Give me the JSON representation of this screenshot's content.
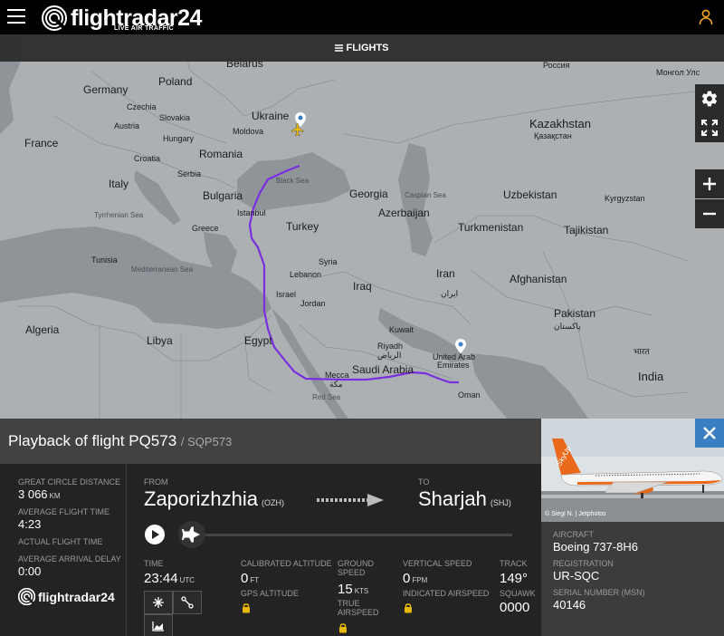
{
  "header": {
    "logo_text": "flightradar24",
    "logo_sub": "LIVE AIR TRAFFIC",
    "flights_label": "FLIGHTS"
  },
  "icons": {
    "menu": "hamburger-icon",
    "user": "user-icon",
    "settings": "gear-icon",
    "fullscreen": "fullscreen-icon",
    "zoom_in": "plus-icon",
    "zoom_out": "minus-icon",
    "close": "close-icon",
    "play": "play-icon",
    "plane": "plane-icon"
  },
  "map": {
    "labels": {
      "belarus": "Belarus",
      "germany": "Germany",
      "poland": "Poland",
      "czechia": "Czechia",
      "slovakia": "Slovakia",
      "austria": "Austria",
      "hungary": "Hungary",
      "ukraine": "Ukraine",
      "moldova": "Moldova",
      "france": "France",
      "romania": "Romania",
      "kazakhstan": "Kazakhstan",
      "kazakhstan_local": "Қазақстан",
      "russia_local": "Россия",
      "mongolia_local": "Монгол Улс",
      "croatia": "Croatia",
      "serbia": "Serbia",
      "italy": "Italy",
      "bulgaria": "Bulgaria",
      "istanbul": "Istanbul",
      "black_sea": "Black Sea",
      "georgia": "Georgia",
      "azerbaijan": "Azerbaijan",
      "caspian": "Caspian Sea",
      "uzbekistan": "Uzbekistan",
      "kyrgyzstan": "Kyrgyzstan",
      "tajikistan": "Tajikistan",
      "turkmenistan": "Turkmenistan",
      "turkey": "Turkey",
      "tyrrhenian": "Tyrrhenian Sea",
      "greece": "Greece",
      "med_sea": "Mediterranean Sea",
      "tunisia": "Tunisia",
      "syria": "Syria",
      "lebanon": "Lebanon",
      "iraq": "Iraq",
      "israel": "Israel",
      "jordan": "Jordan",
      "iran_local": "ایران",
      "iran": "Iran",
      "afghanistan": "Afghanistan",
      "pakistan": "Pakistan",
      "pakistan_local": "پاکستان",
      "algeria": "Algeria",
      "libya": "Libya",
      "egypt": "Egypt",
      "kuwait": "Kuwait",
      "riyadh": "Riyadh",
      "riyadh_local": "الرياض",
      "saudi": "Saudi Arabia",
      "uae": "United Arab",
      "uae2": "Emirates",
      "mecca": "Mecca",
      "mecca_local": "مكة",
      "oman": "Oman",
      "red_sea": "Red Sea",
      "india": "India",
      "india_local": "भारत"
    }
  },
  "panel": {
    "title": "Playback of flight PQ573",
    "callsign": "/ SQP573",
    "great_circle_label": "GREAT CIRCLE DISTANCE",
    "great_circle_value": "3 066",
    "great_circle_unit": "KM",
    "avg_flight_time_label": "AVERAGE FLIGHT TIME",
    "avg_flight_time_value": "4:23",
    "actual_flight_time_label": "ACTUAL FLIGHT TIME",
    "avg_arrival_delay_label": "AVERAGE ARRIVAL DELAY",
    "avg_arrival_delay_value": "0:00",
    "brand": "flightradar24",
    "from_label": "FROM",
    "from_city": "Zaporizhzhia",
    "from_code": "(OZH)",
    "to_label": "TO",
    "to_city": "Sharjah",
    "to_code": "(SHJ)",
    "playback_progress": 0.0,
    "time_label": "TIME",
    "time_value": "23:44",
    "time_unit": "UTC",
    "cal_alt_label": "CALIBRATED ALTITUDE",
    "cal_alt_value": "0",
    "cal_alt_unit": "FT",
    "gps_alt_label": "GPS ALTITUDE",
    "ground_speed_label_1": "GROUND",
    "ground_speed_label_2": "SPEED",
    "ground_speed_value": "15",
    "ground_speed_unit": "KTS",
    "true_airspeed_label_1": "TRUE",
    "true_airspeed_label_2": "AIRSPEED",
    "vert_speed_label": "VERTICAL SPEED",
    "vert_speed_value": "0",
    "vert_speed_unit": "FPM",
    "indicated_airspeed_label": "INDICATED AIRSPEED",
    "track_label": "TRACK",
    "track_value": "149°",
    "squawk_label": "SQUAWK",
    "squawk_value": "0000"
  },
  "aircraft": {
    "photo_credit": "© Siegi N. | Jetphotos",
    "aircraft_label": "AIRCRAFT",
    "aircraft_value": "Boeing 737-8H6",
    "registration_label": "REGISTRATION",
    "registration_value": "UR-SQC",
    "serial_label": "SERIAL NUMBER (MSN)",
    "serial_value": "40146",
    "livery_text": "SkyUp"
  },
  "colors": {
    "track": "#7a2ee0",
    "topbar": "#000000",
    "panel_head": "#424242",
    "close_button": "#3a7fc2",
    "lock": "#e8b800"
  }
}
